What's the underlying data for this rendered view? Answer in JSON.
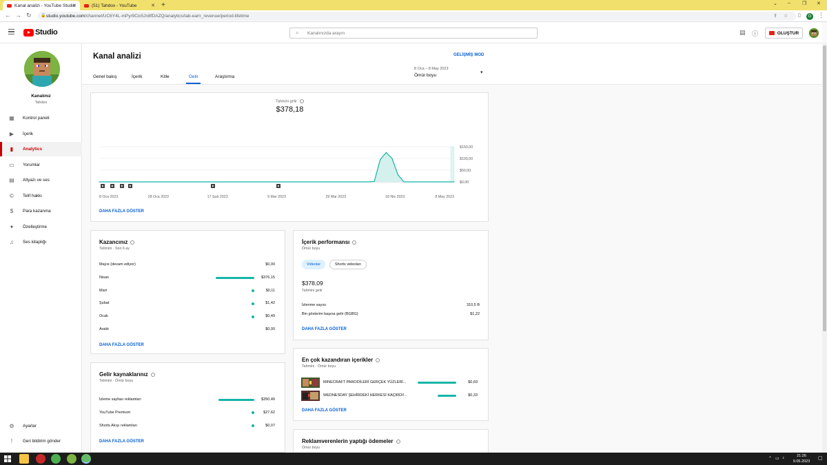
{
  "browser": {
    "tabs": [
      {
        "title": "Kanal analizi - YouTube Studio"
      },
      {
        "title": "(51) Tahdox - YouTube"
      }
    ],
    "url_host": "studio.youtube.com",
    "url_path": "/channel/UC6Y4L-mPyr9Cix5Jn8fDAZQ/analytics/tab-earn_revenue/period-lifetime",
    "profile_initial": "G"
  },
  "header": {
    "studio_word": "Studio",
    "search_placeholder": "Kanalınızda arayın",
    "create_label": "OLUŞTUR"
  },
  "sidebar": {
    "channel_name": "Kanalınız",
    "channel_handle": "Tahdox",
    "items": [
      {
        "label": "Kontrol paneli",
        "icon": "dashboard-icon"
      },
      {
        "label": "İçerik",
        "icon": "content-icon"
      },
      {
        "label": "Analytics",
        "icon": "analytics-icon"
      },
      {
        "label": "Yorumlar",
        "icon": "comments-icon"
      },
      {
        "label": "Altyazı ve ses",
        "icon": "subtitles-icon"
      },
      {
        "label": "Telif hakkı",
        "icon": "copyright-icon"
      },
      {
        "label": "Para kazanma",
        "icon": "monetization-icon"
      },
      {
        "label": "Özelleştirme",
        "icon": "customization-icon"
      },
      {
        "label": "Ses kitaplığı",
        "icon": "audio-library-icon"
      }
    ],
    "bottom": [
      {
        "label": "Ayarlar",
        "icon": "settings-icon"
      },
      {
        "label": "Geri bildirim gönder",
        "icon": "feedback-icon"
      }
    ]
  },
  "page": {
    "title": "Kanal analizi",
    "advanced_mode": "GELİŞMİŞ MOD",
    "tabs": [
      "Genel bakış",
      "İçerik",
      "Kitle",
      "Gelir",
      "Araştırma"
    ],
    "active_tab": "Gelir",
    "date_range": "8 Oca – 8 May 2023",
    "period": "Ömür boyu"
  },
  "chart_data": {
    "type": "line",
    "title": "Tahmini gelir",
    "total": "$378,18",
    "x_ticks": [
      "8 Oca 2023",
      "28 Oca 2023",
      "17 Şub 2023",
      "9 Mar 2023",
      "29 Mar 2023",
      "18 Nis 2023",
      "8 May 2023"
    ],
    "y_ticks": [
      "$150,00",
      "$100,00",
      "$50,00",
      "$0,00"
    ],
    "ylim": [
      0,
      150
    ],
    "series": [
      {
        "x": [
          "2023-01-08",
          "2023-04-09",
          "2023-04-11",
          "2023-04-13",
          "2023-04-15",
          "2023-04-17",
          "2023-04-19",
          "2023-04-21",
          "2023-05-08"
        ],
        "values": [
          0,
          0,
          2,
          95,
          125,
          100,
          30,
          0,
          0
        ]
      }
    ],
    "more_label": "DAHA FAZLA GÖSTER"
  },
  "earnings": {
    "title": "Kazancınız",
    "subtitle": "Tahmini · Son 6 ay",
    "rows": [
      {
        "label": "Mayıs (devam ediyor)",
        "value": "$0,00",
        "share": 0
      },
      {
        "label": "Nisan",
        "value": "$376,15",
        "share": 0.994
      },
      {
        "label": "Mart",
        "value": "$0,11",
        "share": 0.0003
      },
      {
        "label": "Şubat",
        "value": "$1,42",
        "share": 0.004
      },
      {
        "label": "Ocak",
        "value": "$0,49",
        "share": 0.0013
      },
      {
        "label": "Aralık",
        "value": "$0,00",
        "share": 0
      }
    ],
    "more_label": "DAHA FAZLA GÖSTER"
  },
  "revenue_sources": {
    "title": "Gelir kaynaklarınız",
    "subtitle": "Tahmini · Ömür boyu",
    "rows": [
      {
        "label": "İzleme sayfası reklamları",
        "value": "$350,49",
        "share": 0.927
      },
      {
        "label": "YouTube Premium",
        "value": "$27,62",
        "share": 0.073
      },
      {
        "label": "Shorts Akışı reklamları",
        "value": "$0,07",
        "share": 0.0002
      }
    ],
    "more_label": "DAHA FAZLA GÖSTER"
  },
  "content_perf": {
    "title": "İçerik performansı",
    "subtitle": "Ömür boyu",
    "pills": [
      "Videolar",
      "Shorts videoları"
    ],
    "amount": "$378,09",
    "amount_label": "Tahmini gelir",
    "stats": [
      {
        "label": "İzlenme sayısı",
        "value": "310,5 B"
      },
      {
        "label": "Bin gösterim başına gelir (BGBG)",
        "value": "$1,22"
      }
    ],
    "more_label": "DAHA FAZLA GÖSTER"
  },
  "top_content": {
    "title": "En çok kazandıran içerikler",
    "subtitle": "Tahmini · Ömür boyu",
    "rows": [
      {
        "title": "MINECRAFT PARODİLERİ GERÇEK YÜZLERİ...",
        "value": "$0,69",
        "share": 1.0
      },
      {
        "title": "WEDNESDAY ŞEHİRDEKİ HERKESİ KAÇIRDI!...",
        "value": "$0,33",
        "share": 0.48
      }
    ],
    "more_label": "DAHA FAZLA GÖSTER"
  },
  "advertisers": {
    "title": "Reklamverenlerin yaptığı ödemeler",
    "subtitle": "Ömür boyu"
  },
  "taskbar": {
    "time": "21:26",
    "date": "9.05.2023"
  },
  "colors": {
    "accent_teal": "#12b5a6",
    "link_blue": "#065fd4",
    "active_red": "#cc0000",
    "tab_bar": "#f1e06b"
  }
}
